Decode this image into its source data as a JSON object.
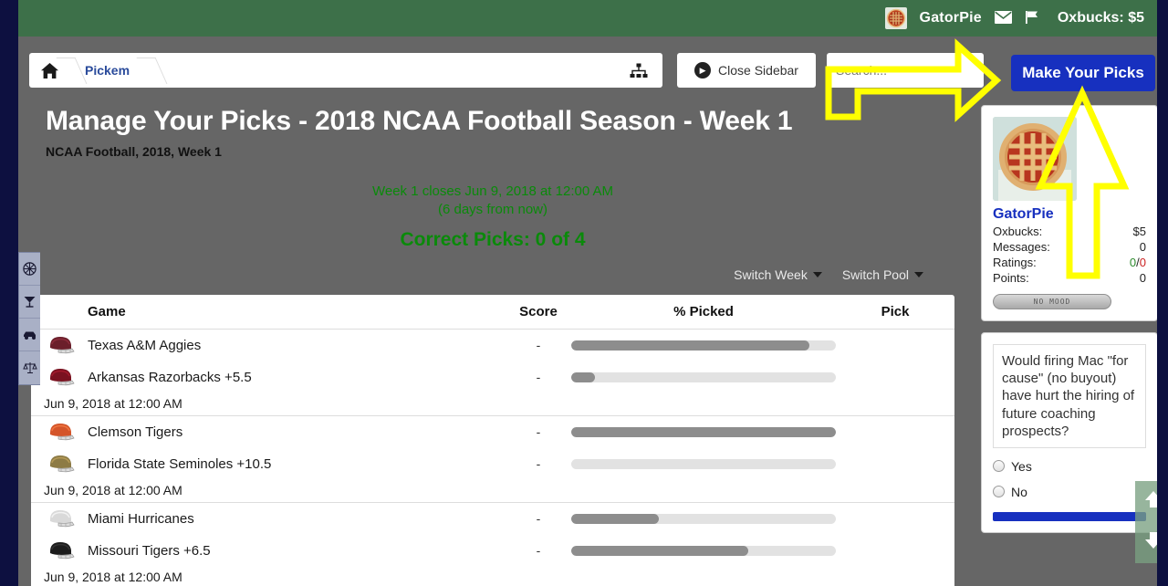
{
  "topbar": {
    "username": "GatorPie",
    "avatar_icon": "pie-avatar",
    "messages_icon": "envelope-icon",
    "flag_icon": "flag-icon",
    "oxbucks": "Oxbucks: $5"
  },
  "toolbar": {
    "home_icon": "home-icon",
    "breadcrumb": "Pickem",
    "sitemap_icon": "sitemap-icon",
    "close_sidebar": "Close Sidebar",
    "sidebar_icon": "arrow-right-circle-icon",
    "search_placeholder": "Search...",
    "search_value": "",
    "search_icon": "magnifier-icon",
    "make_picks": "Make Your Picks"
  },
  "main": {
    "title": "Manage Your Picks - 2018 NCAA Football Season - Week 1",
    "subtitle": "NCAA Football, 2018, Week 1",
    "closes_line": "Week 1 closes Jun 9, 2018 at 12:00 AM",
    "days_line": "(6 days from now)",
    "correct_picks": "Correct Picks: 0 of 4",
    "switch_week": "Switch Week",
    "switch_pool": "Switch Pool"
  },
  "table": {
    "headers": {
      "game": "Game",
      "score": "Score",
      "pct_picked": "% Picked",
      "pick": "Pick"
    },
    "games": [
      {
        "date": "Jun 9, 2018 at 12:00 AM",
        "teams": [
          {
            "name": "Texas A&M Aggies",
            "score": "-",
            "pct": 90,
            "helmet": "maroon"
          },
          {
            "name": "Arkansas Razorbacks +5.5",
            "score": "-",
            "pct": 9,
            "helmet": "cardinal"
          }
        ]
      },
      {
        "date": "Jun 9, 2018 at 12:00 AM",
        "teams": [
          {
            "name": "Clemson Tigers",
            "score": "-",
            "pct": 100,
            "helmet": "orange"
          },
          {
            "name": "Florida State Seminoles +10.5",
            "score": "-",
            "pct": 0,
            "helmet": "gold"
          }
        ]
      },
      {
        "date": "Jun 9, 2018 at 12:00 AM",
        "teams": [
          {
            "name": "Miami Hurricanes",
            "score": "-",
            "pct": 33,
            "helmet": "white"
          },
          {
            "name": "Missouri Tigers +6.5",
            "score": "-",
            "pct": 67,
            "helmet": "black"
          }
        ]
      }
    ]
  },
  "profile": {
    "avatar_icon": "pie-avatar-large",
    "name": "GatorPie",
    "stats": [
      {
        "label": "Oxbucks:",
        "value": "$5"
      },
      {
        "label": "Messages:",
        "value": "0"
      },
      {
        "label": "Points:",
        "value": "0"
      }
    ],
    "ratings_label": "Ratings:",
    "ratings_good": "0",
    "ratings_sep": "/",
    "ratings_bad": "0",
    "mood": "NO MOOD"
  },
  "poll": {
    "question": "Would firing Mac \"for cause\" (no buyout) have hurt the hiring of future coaching prospects?",
    "options": [
      "Yes",
      "No"
    ]
  },
  "rail": {
    "items": [
      "basketball-icon",
      "martini-icon",
      "car-icon",
      "scales-icon"
    ]
  },
  "scroll": {
    "up": "⬆",
    "down": "⬇"
  },
  "colors": {
    "header_green": "#3d7049",
    "body_gray": "#666666",
    "accent_blue": "#1730bf",
    "search_orange": "#ef3b0c",
    "success_green": "#0a8a0a",
    "annotation_yellow": "#ffff00"
  }
}
